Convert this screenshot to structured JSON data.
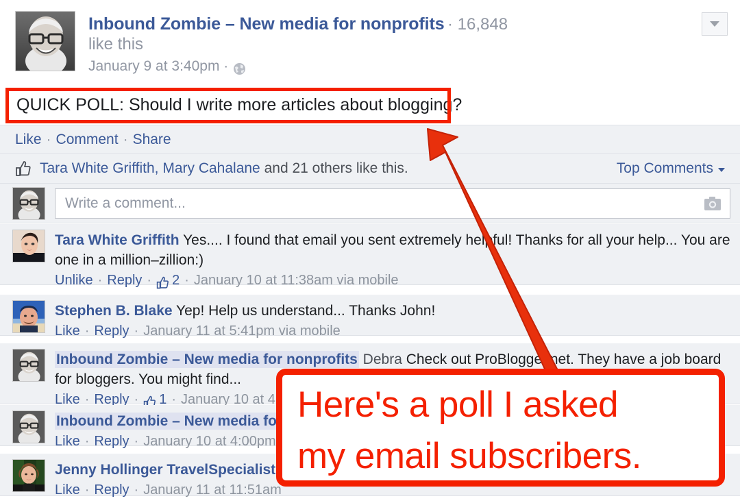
{
  "post": {
    "page_name": "Inbound Zombie – New media for nonprofits",
    "like_count": "· 16,848",
    "like_this": "like this",
    "timestamp": "January 9 at 3:40pm ·",
    "privacy_icon": "globe-icon",
    "menu_icon": "chevron-down-icon",
    "message": "QUICK POLL: Should I write more articles about blogging?"
  },
  "actions": {
    "like": "Like",
    "comment": "Comment",
    "share": "Share",
    "sep": "·"
  },
  "likes_bar": {
    "thumb_icon": "thumbs-up-icon",
    "names": "Tara White Griffith, Mary Cahalane",
    "rest": " and 21 others like this.",
    "sort_label": "Top Comments",
    "sort_caret": "chevron-down-icon"
  },
  "composer": {
    "placeholder": "Write a comment...",
    "camera_icon": "camera-icon"
  },
  "comments": [
    {
      "author": "Tara White Griffith",
      "mention": "",
      "reply_to": "",
      "text": " Yes.... I found that email you sent extremely helpful! Thanks for all your help... You are one in a million–zillion:)",
      "like_label": "Unlike",
      "reply_label": "Reply",
      "like_count": "2",
      "timestamp": "January 10 at 11:38am via mobile",
      "avatar": "avatar-tara"
    },
    {
      "author": "Stephen B. Blake",
      "mention": "",
      "reply_to": "",
      "text": " Yep! Help us understand... Thanks John!",
      "like_label": "Like",
      "reply_label": "Reply",
      "like_count": "",
      "timestamp": "January 11 at 5:41pm via mobile",
      "avatar": "avatar-zombie"
    },
    {
      "author": "",
      "mention": "Inbound Zombie – New media for nonprofits",
      "reply_to": " Debra",
      "text": " Check out ProBlogger.net. They have a job board for bloggers. You might find...",
      "like_label": "Like",
      "reply_label": "Reply",
      "like_count": "1",
      "timestamp": "January 10 at 4:...",
      "avatar": "avatar-zombie"
    },
    {
      "author": "",
      "mention": "Inbound Zombie – New media fo...",
      "reply_to": "",
      "text": "",
      "like_label": "Like",
      "reply_label": "Reply",
      "like_count": "",
      "timestamp": "January 10 at 4:00pm",
      "avatar": "avatar-zombie"
    },
    {
      "author": "Jenny Hollinger TravelSpecialist",
      "mention": "",
      "reply_to": "",
      "text": "",
      "like_label": "Like",
      "reply_label": "Reply",
      "like_count": "",
      "timestamp": "January 11 at 11:51am",
      "avatar": "avatar-jenny"
    }
  ],
  "annotation": {
    "line1": "Here's a poll I asked",
    "line2": "my email subscribers.",
    "color": "#f42000",
    "arrow_icon": "arrow-up-left-icon",
    "highlight_icon": "highlight-box"
  }
}
